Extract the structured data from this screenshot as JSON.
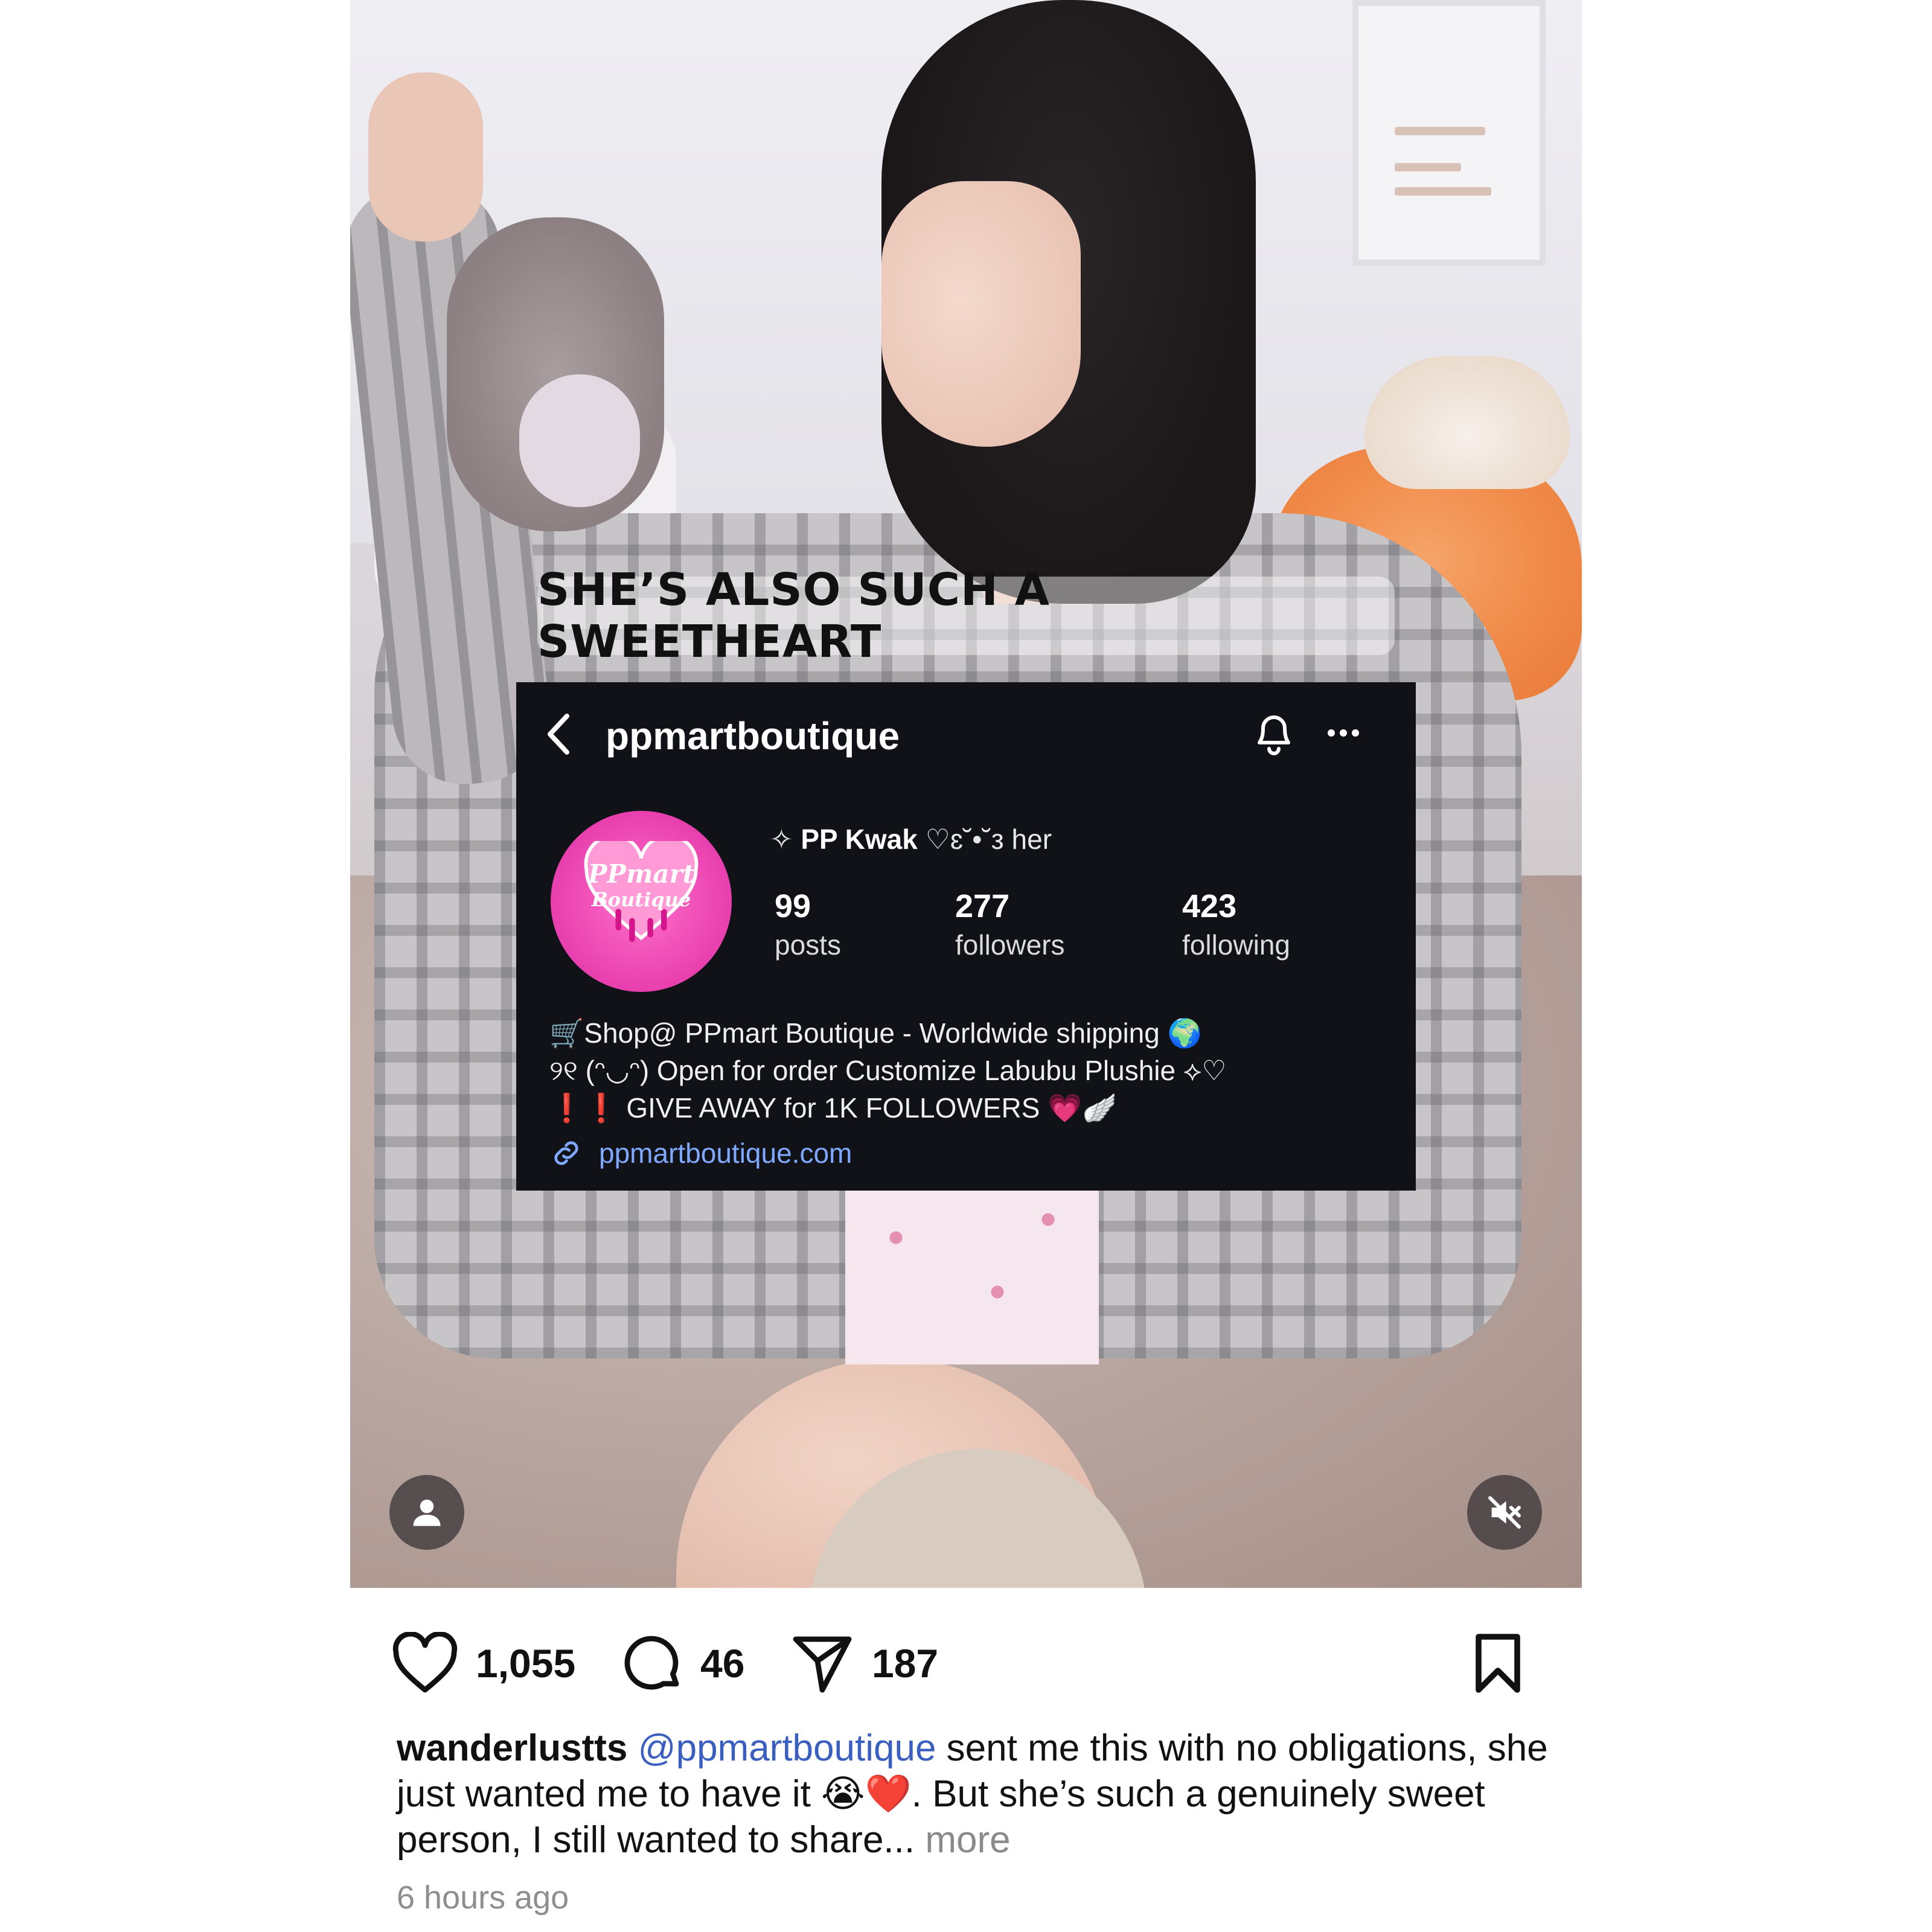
{
  "post": {
    "overlay_caption": "SHE’S ALSO SUCH A SWEETHEART",
    "profile_card": {
      "username": "ppmartboutique",
      "display_name_prefix": "✧ ",
      "display_name": "PP Kwak",
      "display_name_suffix": " ♡ɛ˘•˘з her",
      "avatar_text_1": "PPmart",
      "avatar_text_2": "Boutique",
      "stats": [
        {
          "value": "99",
          "label": "posts"
        },
        {
          "value": "277",
          "label": "followers"
        },
        {
          "value": "423",
          "label": "following"
        }
      ],
      "bio_lines": [
        "🛒Shop@ PPmart Boutique - Worldwide shipping 🌍",
        "୨୧ (ᵔ◡ᵔ) Open for order Customize Labubu Plushie ⟡♡",
        "❗❗ GIVE AWAY for 1K FOLLOWERS 💗🪽"
      ],
      "link": "ppmartboutique.com"
    },
    "actions": {
      "likes": "1,055",
      "comments": "46",
      "shares": "187"
    },
    "caption": {
      "username": "wanderlustts",
      "mention": "@ppmartboutique",
      "text": " sent me this with no obligations, she just wanted me to have it 😭❤️. But she’s such a genuinely sweet person, I still wanted to share...",
      "more_label": " more"
    },
    "timestamp": "6 hours ago"
  },
  "icons": {
    "like": "heart-icon",
    "comment": "comment-bubble-icon",
    "share": "paper-plane-icon",
    "save": "bookmark-icon",
    "tag_people": "person-icon",
    "mute": "speaker-muted-icon"
  }
}
